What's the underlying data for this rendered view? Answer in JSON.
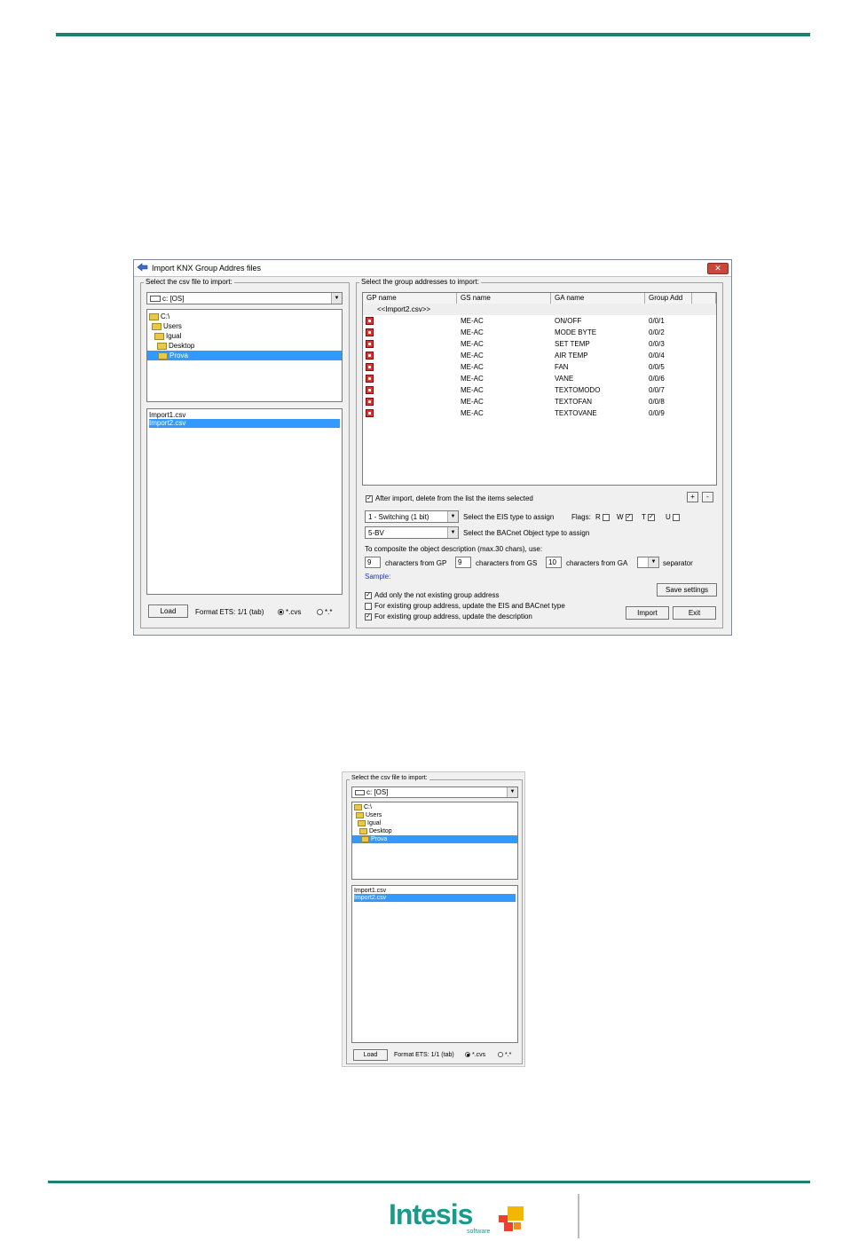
{
  "main_window": {
    "title": "Import KNX Group Addres files",
    "close_label": "✕",
    "left_group_label": "Select the csv file to import:",
    "drive": "c: [OS]",
    "tree": [
      "C:\\",
      "Users",
      "Igual",
      "Desktop",
      "Prova"
    ],
    "files": [
      "Import1.csv",
      "Import2.csv"
    ],
    "load_button": "Load",
    "format_label": "Format ETS: 1/1 (tab)",
    "radio_csv": "*.cvs",
    "radio_all": "*.*",
    "right_group_label": "Select the group addresses to import:",
    "columns": [
      "GP name",
      "GS name",
      "GA name",
      "Group Add"
    ],
    "root_row": "<<Import2.csv>>",
    "rows": [
      {
        "gs": "ME-AC",
        "ga": "ON/OFF",
        "addr": "0/0/1"
      },
      {
        "gs": "ME-AC",
        "ga": "MODE BYTE",
        "addr": "0/0/2"
      },
      {
        "gs": "ME-AC",
        "ga": "SET TEMP",
        "addr": "0/0/3"
      },
      {
        "gs": "ME-AC",
        "ga": "AIR TEMP",
        "addr": "0/0/4"
      },
      {
        "gs": "ME-AC",
        "ga": "FAN",
        "addr": "0/0/5"
      },
      {
        "gs": "ME-AC",
        "ga": "VANE",
        "addr": "0/0/6"
      },
      {
        "gs": "ME-AC",
        "ga": "TEXTOMODO",
        "addr": "0/0/7"
      },
      {
        "gs": "ME-AC",
        "ga": "TEXTOFAN",
        "addr": "0/0/8"
      },
      {
        "gs": "ME-AC",
        "ga": "TEXTOVANE",
        "addr": "0/0/9"
      }
    ],
    "after_import_label": "After import, delete from the list the items selected",
    "plus_label": "+",
    "minus_label": "-",
    "eis_value": "1 - Switching (1 bit)",
    "eis_label": "Select the EIS type to assign",
    "flags_label": "Flags:",
    "flag_r": "R",
    "flag_w": "W",
    "flag_t": "T",
    "flag_u": "U",
    "bacnet_value": "5-BV",
    "bacnet_label": "Select the BACnet Object type to assign",
    "compose_label": "To composite the object description (max.30 chars), use:",
    "gp_chars": "9",
    "gp_chars_label": "characters from GP",
    "gs_chars": "9",
    "gs_chars_label": "characters from GS",
    "ga_chars": "10",
    "ga_chars_label": "characters from GA",
    "separator_label": "separator",
    "sample_label": "Sample:",
    "save_settings": "Save settings",
    "opt_add_only": "Add only the not existing group address",
    "opt_update_eis": "For existing group address, update the EIS and BACnet type",
    "opt_update_desc": "For existing group address, update the description",
    "import_button": "Import",
    "exit_button": "Exit"
  },
  "zoom_panel": {
    "group_label": "Select the csv file to import:",
    "drive": "c: [OS]",
    "tree": [
      "C:\\",
      "Users",
      "Igual",
      "Desktop",
      "Prova"
    ],
    "files": [
      "Import1.csv",
      "Import2.csv"
    ],
    "load_button": "Load",
    "format_label": "Format ETS: 1/1 (tab)",
    "radio_csv": "*.cvs",
    "radio_all": "*.*"
  },
  "footer": {
    "logo": "Intesis",
    "logo_sub": "software"
  },
  "colors": {
    "accent": "#1a7f74",
    "selection": "#3399ff"
  }
}
